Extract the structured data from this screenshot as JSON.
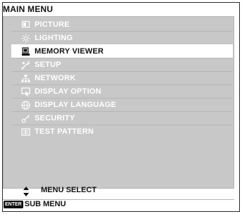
{
  "title": "MAIN MENU",
  "menu": {
    "items": [
      {
        "label": "PICTURE",
        "icon": "picture-icon"
      },
      {
        "label": "LIGHTING",
        "icon": "lighting-icon"
      },
      {
        "label": "MEMORY VIEWER",
        "icon": "memory-viewer-icon",
        "selected": true
      },
      {
        "label": "SETUP",
        "icon": "setup-icon"
      },
      {
        "label": "NETWORK",
        "icon": "network-icon"
      },
      {
        "label": "DISPLAY OPTION",
        "icon": "display-option-icon"
      },
      {
        "label": "DISPLAY LANGUAGE",
        "icon": "globe-icon"
      },
      {
        "label": "SECURITY",
        "icon": "key-icon"
      },
      {
        "label": "TEST PATTERN",
        "icon": "test-pattern-icon"
      }
    ]
  },
  "footer": {
    "menu_select": "MENU SELECT",
    "enter_key": "ENTER",
    "sub_menu": "SUB MENU"
  },
  "colors": {
    "panel": "#c8c8c8",
    "selected_bg": "#ffffff",
    "item_text": "#ffffff"
  }
}
